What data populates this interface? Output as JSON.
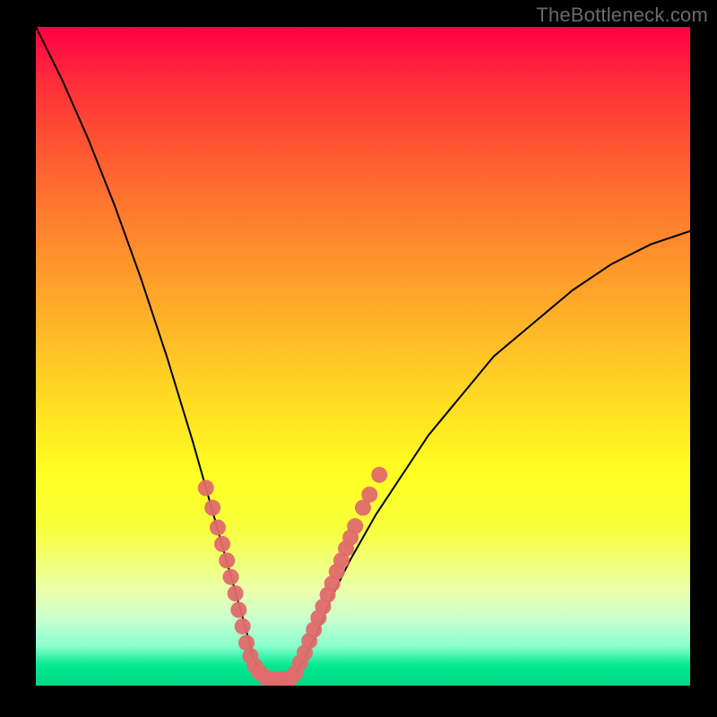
{
  "watermark": "TheBottleneck.com",
  "chart_data": {
    "type": "line",
    "title": "",
    "xlabel": "",
    "ylabel": "",
    "xlim": [
      0,
      100
    ],
    "ylim": [
      0,
      100
    ],
    "series": [
      {
        "name": "curve",
        "x": [
          0,
          4,
          8,
          12,
          16,
          20,
          24,
          26,
          28,
          30,
          32,
          33,
          34,
          35,
          36,
          37,
          39,
          41,
          43,
          45,
          48,
          52,
          56,
          60,
          65,
          70,
          76,
          82,
          88,
          94,
          100
        ],
        "y": [
          100,
          92,
          83,
          73,
          62,
          50,
          37,
          30,
          23,
          16,
          9,
          5,
          2,
          1,
          1,
          1,
          1,
          4,
          8,
          13,
          19,
          26,
          32,
          38,
          44,
          50,
          55,
          60,
          64,
          67,
          69
        ],
        "color": "#000000",
        "width": 2
      }
    ],
    "markers": [
      {
        "name": "scatter-points",
        "color": "#e06c6c",
        "radius": 9,
        "points": [
          {
            "x": 26.0,
            "y": 30.0
          },
          {
            "x": 27.0,
            "y": 27.0
          },
          {
            "x": 27.8,
            "y": 24.0
          },
          {
            "x": 28.5,
            "y": 21.5
          },
          {
            "x": 29.2,
            "y": 19.0
          },
          {
            "x": 29.8,
            "y": 16.5
          },
          {
            "x": 30.5,
            "y": 14.0
          },
          {
            "x": 31.0,
            "y": 11.5
          },
          {
            "x": 31.6,
            "y": 9.0
          },
          {
            "x": 32.2,
            "y": 6.5
          },
          {
            "x": 32.8,
            "y": 4.5
          },
          {
            "x": 33.5,
            "y": 3.0
          },
          {
            "x": 34.2,
            "y": 2.0
          },
          {
            "x": 35.0,
            "y": 1.3
          },
          {
            "x": 35.8,
            "y": 1.0
          },
          {
            "x": 36.6,
            "y": 1.0
          },
          {
            "x": 37.4,
            "y": 1.0
          },
          {
            "x": 38.2,
            "y": 1.0
          },
          {
            "x": 39.0,
            "y": 1.2
          },
          {
            "x": 39.7,
            "y": 2.0
          },
          {
            "x": 40.4,
            "y": 3.5
          },
          {
            "x": 41.1,
            "y": 5.0
          },
          {
            "x": 41.8,
            "y": 6.8
          },
          {
            "x": 42.5,
            "y": 8.5
          },
          {
            "x": 43.2,
            "y": 10.3
          },
          {
            "x": 43.9,
            "y": 12.0
          },
          {
            "x": 44.6,
            "y": 13.8
          },
          {
            "x": 45.3,
            "y": 15.5
          },
          {
            "x": 46.0,
            "y": 17.3
          },
          {
            "x": 46.7,
            "y": 19.0
          },
          {
            "x": 47.4,
            "y": 20.8
          },
          {
            "x": 48.1,
            "y": 22.5
          },
          {
            "x": 48.8,
            "y": 24.2
          },
          {
            "x": 50.0,
            "y": 27.0
          },
          {
            "x": 51.0,
            "y": 29.0
          },
          {
            "x": 52.5,
            "y": 32.0
          }
        ]
      }
    ]
  }
}
